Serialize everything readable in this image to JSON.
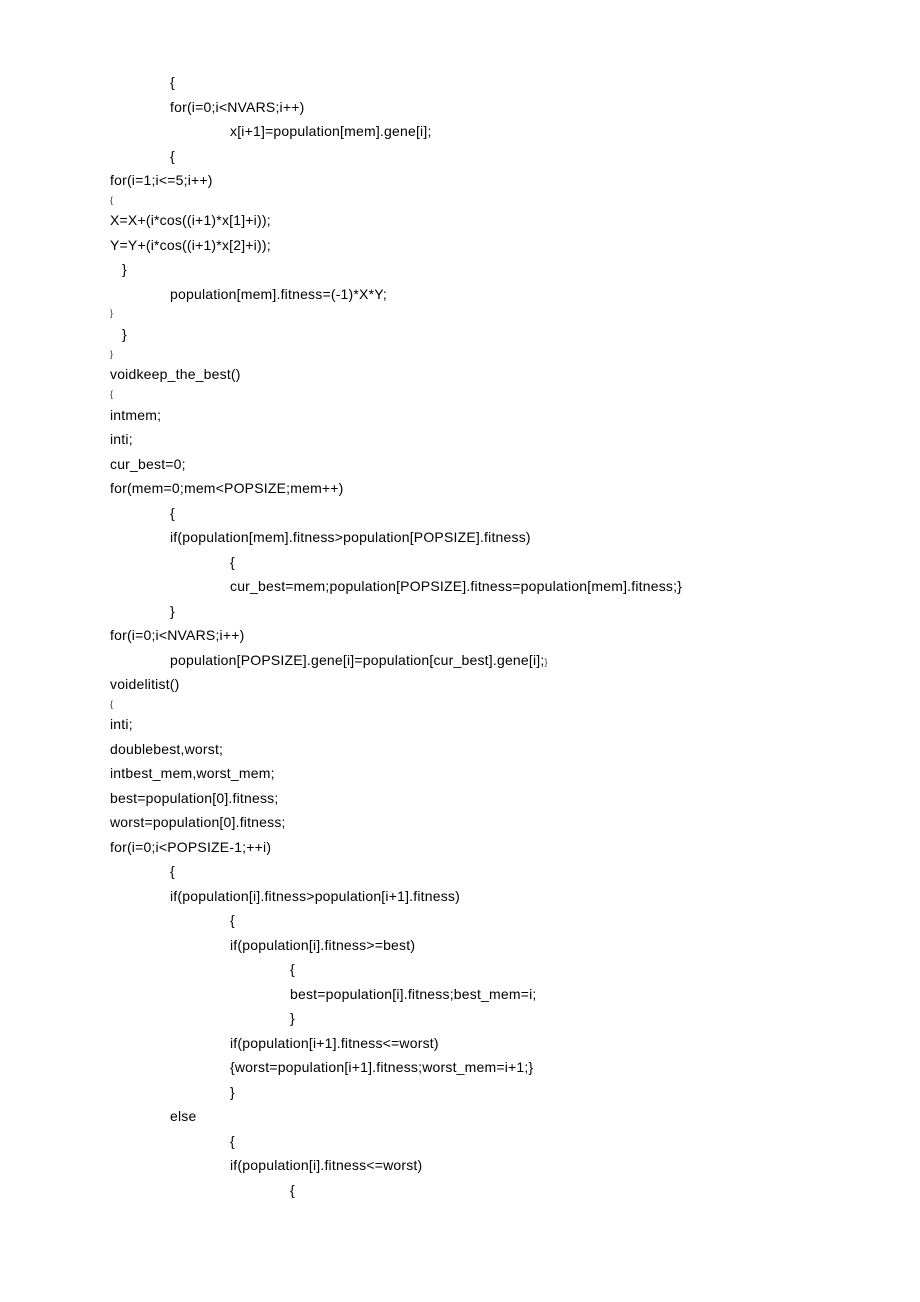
{
  "lines": [
    {
      "cls": "indent1",
      "text": "{"
    },
    {
      "cls": "indent1",
      "text": "for(i=0;i<NVARS;i++)"
    },
    {
      "cls": "indent2",
      "text": "x[i+1]=population[mem].gene[i];"
    },
    {
      "cls": "indent1",
      "text": "{"
    },
    {
      "cls": "indent0",
      "text": "for(i=1;i<=5;i++)"
    },
    {
      "cls": "indent0 tiny",
      "text": "{"
    },
    {
      "cls": "indent0",
      "text": "X=X+(i*cos((i+1)*x[1]+i));"
    },
    {
      "cls": "indent0",
      "text": "Y=Y+(i*cos((i+1)*x[2]+i));"
    },
    {
      "cls": "indent-half",
      "text": "}"
    },
    {
      "cls": "indent1",
      "text": "population[mem].fitness=(-1)*X*Y;"
    },
    {
      "cls": "indent0 tiny",
      "text": "}"
    },
    {
      "cls": "indent-half",
      "text": "}"
    },
    {
      "cls": "indent0 tiny",
      "text": "}"
    },
    {
      "cls": "indent0",
      "text": "voidkeep_the_best()"
    },
    {
      "cls": "indent0 tiny",
      "text": "{"
    },
    {
      "cls": "indent0",
      "text": "intmem;"
    },
    {
      "cls": "indent0",
      "text": "inti;"
    },
    {
      "cls": "indent0",
      "text": "cur_best=0;"
    },
    {
      "cls": "indent0",
      "text": "for(mem=0;mem<POPSIZE;mem++)"
    },
    {
      "cls": "indent1",
      "text": "{"
    },
    {
      "cls": "indent1",
      "text": "if(population[mem].fitness>population[POPSIZE].fitness)"
    },
    {
      "cls": "indent2",
      "text": "{"
    },
    {
      "cls": "indent2",
      "text": "cur_best=mem;population[POPSIZE].fitness=population[mem].fitness;}"
    },
    {
      "cls": "indent1",
      "text": "}"
    },
    {
      "cls": "indent0",
      "text": "for(i=0;i<NVARS;i++)"
    },
    {
      "cls": "indent1",
      "text": "population[POPSIZE].gene[i]=population[cur_best].gene[i];",
      "trail_tiny": "}"
    },
    {
      "cls": "indent0",
      "text": "voidelitist()"
    },
    {
      "cls": "indent0 tiny",
      "text": "{"
    },
    {
      "cls": "indent0",
      "text": "inti;"
    },
    {
      "cls": "indent0",
      "text": "doublebest,worst;"
    },
    {
      "cls": "indent0",
      "text": "intbest_mem,worst_mem;"
    },
    {
      "cls": "indent0",
      "text": "best=population[0].fitness;"
    },
    {
      "cls": "indent0",
      "text": "worst=population[0].fitness;"
    },
    {
      "cls": "indent0",
      "text": "for(i=0;i<POPSIZE-1;++i)"
    },
    {
      "cls": "indent1",
      "text": "{"
    },
    {
      "cls": "indent1",
      "text": "if(population[i].fitness>population[i+1].fitness)"
    },
    {
      "cls": "indent2",
      "text": "{"
    },
    {
      "cls": "indent2",
      "text": "if(population[i].fitness>=best)"
    },
    {
      "cls": "indent3",
      "text": "{"
    },
    {
      "cls": "indent3",
      "text": "best=population[i].fitness;best_mem=i;"
    },
    {
      "cls": "indent3",
      "text": "}"
    },
    {
      "cls": "indent2",
      "text": "if(population[i+1].fitness<=worst)"
    },
    {
      "cls": "indent2",
      "text": ""
    },
    {
      "cls": "indent2",
      "text": "{worst=population[i+1].fitness;worst_mem=i+1;}"
    },
    {
      "cls": "indent2",
      "text": ""
    },
    {
      "cls": "indent2",
      "text": "}"
    },
    {
      "cls": "indent1",
      "text": "else"
    },
    {
      "cls": "indent2",
      "text": "{"
    },
    {
      "cls": "indent2",
      "text": "if(population[i].fitness<=worst)"
    },
    {
      "cls": "indent3",
      "text": "{"
    }
  ]
}
